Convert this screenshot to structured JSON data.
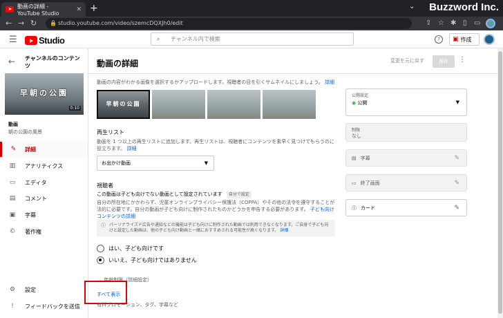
{
  "browser": {
    "tab_title": "動画の詳細 - YouTube Studio",
    "url": "studio.youtube.com/video/szemcDQXJh0/edit",
    "brand": "Buzzword Inc."
  },
  "header": {
    "logo_text": "Studio",
    "search_placeholder": "チャンネル内で検索",
    "help": "?",
    "create_label": "作成"
  },
  "sidebar": {
    "channel_title": "チャンネルのコンテンツ",
    "thumb_title": "早朝の公園",
    "thumb_duration": "0:10",
    "video_label": "動画",
    "video_name": "朝の公園の風景",
    "items": [
      {
        "label": "詳細",
        "icon": "✎"
      },
      {
        "label": "アナリティクス",
        "icon": "▥"
      },
      {
        "label": "エディタ",
        "icon": "▭"
      },
      {
        "label": "コメント",
        "icon": "▤"
      },
      {
        "label": "字幕",
        "icon": "▣"
      },
      {
        "label": "著作権",
        "icon": "©"
      },
      {
        "label": "設定",
        "icon": "⚙"
      },
      {
        "label": "フィードバックを送信",
        "icon": "!"
      }
    ]
  },
  "main": {
    "title": "動画の詳細",
    "undo_label": "変更を元に戻す",
    "save_label": "保存",
    "thumb_desc": "動画の内容がわかる画像を選択するかアップロードします。視聴者の目を引くサムネイルにしましょう。",
    "thumb_desc_link": "詳細",
    "thumb_selected_title": "早朝の公園",
    "playlist_heading": "再生リスト",
    "playlist_desc": "動画を 1 つ以上の再生リストに追加します。再生リストは、視聴者にコンテンツを素早く見つけてもらうのに役立ちます。",
    "playlist_link": "詳細",
    "playlist_value": "お出かけ動画",
    "audience_heading": "視聴者",
    "audience_status": "この動画は子ども向けでない動画として設定されています",
    "audience_badge": "自分で設定",
    "audience_desc": "自分の所在地にかかわらず、児童オンラインプライバシー保護法（COPPA）やその他の法令を遵守することが法的に必要です。自分の動画が子ども向けに制作されたものかどうかを申告する必要があります。",
    "audience_link": "子ども向けコンテンツの詳細",
    "notice": "パーソナライズド広告や通知などの機能は子ども向けに制作された動画では利用できなくなります。ご自身で子ども向けと設定した動画は、他の子ども向け動画と一緒におすすめされる可能性が高くなります。",
    "notice_link": "詳細",
    "radio_yes": "はい、子ども向けです",
    "radio_no": "いいえ、子ども向けではありません",
    "age_restriction": "年齢制限（詳細設定）",
    "show_all": "すべて表示",
    "show_all_sub": "有料プロモーション、タグ、字幕など"
  },
  "right": {
    "visibility_label": "公開設定",
    "visibility_value": "公開",
    "restriction_label": "制限",
    "restriction_value": "なし",
    "subtitles": "字幕",
    "end_screen": "終了画面",
    "cards": "カード"
  }
}
